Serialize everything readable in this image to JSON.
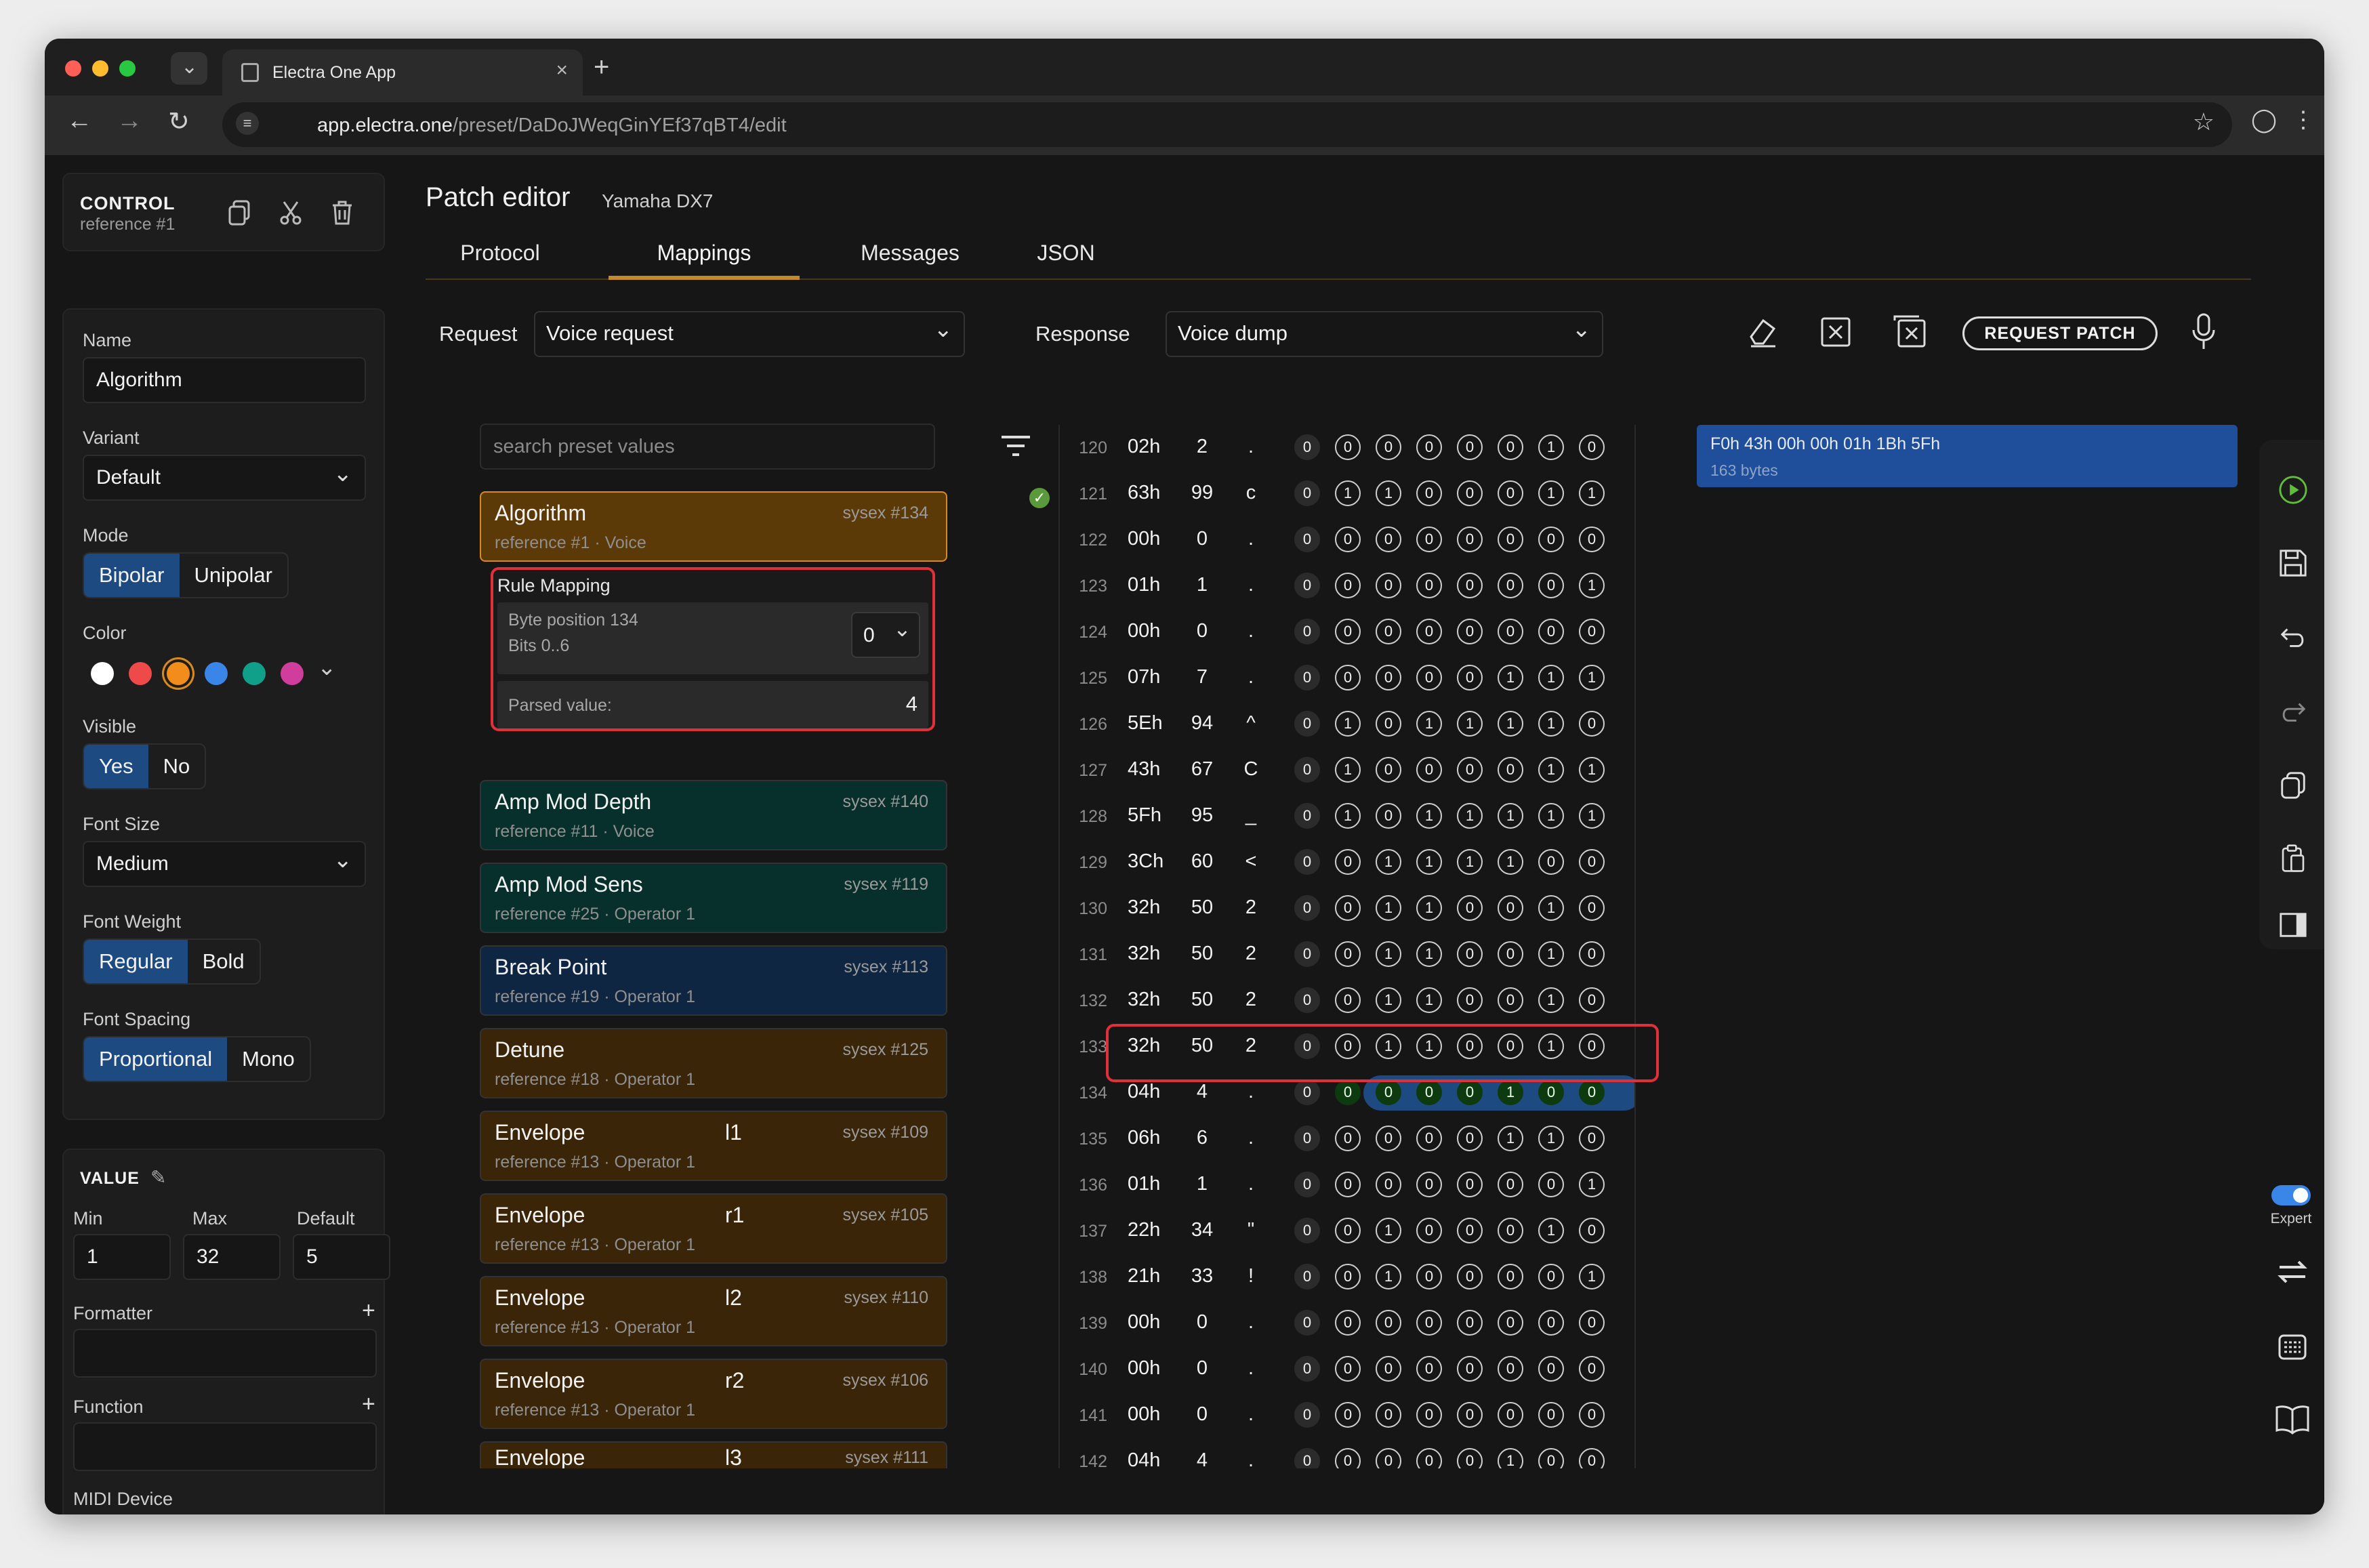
{
  "browser": {
    "tab_title": "Electra One App",
    "url_host": "app.electra.one",
    "url_path": "/preset/DaDoJWeqGinYEf37qBT4/edit"
  },
  "control": {
    "title": "CONTROL",
    "ref": "reference #1"
  },
  "props": {
    "name_label": "Name",
    "name_value": "Algorithm",
    "variant_label": "Variant",
    "variant_value": "Default",
    "mode_label": "Mode",
    "mode_options": [
      "Bipolar",
      "Unipolar"
    ],
    "color_label": "Color",
    "colors": [
      "#ffffff",
      "#ef4a4a",
      "#f28c1a",
      "#3a86e8",
      "#10a08a",
      "#d13d9c"
    ],
    "visible_label": "Visible",
    "visible_options": [
      "Yes",
      "No"
    ],
    "fontsize_label": "Font Size",
    "fontsize_value": "Medium",
    "fontweight_label": "Font Weight",
    "fontweight_options": [
      "Regular",
      "Bold"
    ],
    "fontspacing_label": "Font Spacing",
    "fontspacing_options": [
      "Proportional",
      "Mono"
    ]
  },
  "value": {
    "title": "VALUE",
    "min_label": "Min",
    "max_label": "Max",
    "default_label": "Default",
    "min": "1",
    "max": "32",
    "default": "5",
    "formatter_label": "Formatter",
    "function_label": "Function",
    "midi_label": "MIDI Device"
  },
  "editor": {
    "title": "Patch editor",
    "device": "Yamaha DX7",
    "tabs": [
      "Protocol",
      "Mappings",
      "Messages",
      "JSON"
    ],
    "request_label": "Request",
    "request_value": "Voice request",
    "response_label": "Response",
    "response_value": "Voice dump",
    "request_patch": "REQUEST PATCH",
    "search_placeholder": "search preset values"
  },
  "rule": {
    "title": "Rule Mapping",
    "byte_pos": "Byte position 134",
    "bits": "Bits 0..6",
    "select": "0",
    "parsed_label": "Parsed value:",
    "parsed_value": "4"
  },
  "mappings": [
    {
      "name": "Algorithm",
      "extra": "",
      "sysex": "sysex #134",
      "ref": "reference #1 · Voice"
    },
    {
      "name": "Amp Mod Depth",
      "extra": "",
      "sysex": "sysex #140",
      "ref": "reference #11 · Voice"
    },
    {
      "name": "Amp Mod Sens",
      "extra": "",
      "sysex": "sysex #119",
      "ref": "reference #25 · Operator 1"
    },
    {
      "name": "Break Point",
      "extra": "",
      "sysex": "sysex #113",
      "ref": "reference #19 · Operator 1"
    },
    {
      "name": "Detune",
      "extra": "",
      "sysex": "sysex #125",
      "ref": "reference #18 · Operator 1"
    },
    {
      "name": "Envelope",
      "extra": "l1",
      "sysex": "sysex #109",
      "ref": "reference #13 · Operator 1"
    },
    {
      "name": "Envelope",
      "extra": "r1",
      "sysex": "sysex #105",
      "ref": "reference #13 · Operator 1"
    },
    {
      "name": "Envelope",
      "extra": "l2",
      "sysex": "sysex #110",
      "ref": "reference #13 · Operator 1"
    },
    {
      "name": "Envelope",
      "extra": "r2",
      "sysex": "sysex #106",
      "ref": "reference #13 · Operator 1"
    },
    {
      "name": "Envelope",
      "extra": "l3",
      "sysex": "sysex #111",
      "ref": ""
    }
  ],
  "bytes": [
    {
      "i": "120",
      "hex": "02h",
      "dec": "2",
      "chr": ".",
      "bits": "00000010"
    },
    {
      "i": "121",
      "hex": "63h",
      "dec": "99",
      "chr": "c",
      "bits": "01100011"
    },
    {
      "i": "122",
      "hex": "00h",
      "dec": "0",
      "chr": ".",
      "bits": "00000000"
    },
    {
      "i": "123",
      "hex": "01h",
      "dec": "1",
      "chr": ".",
      "bits": "00000001"
    },
    {
      "i": "124",
      "hex": "00h",
      "dec": "0",
      "chr": ".",
      "bits": "00000000"
    },
    {
      "i": "125",
      "hex": "07h",
      "dec": "7",
      "chr": ".",
      "bits": "00000111"
    },
    {
      "i": "126",
      "hex": "5Eh",
      "dec": "94",
      "chr": "^",
      "bits": "01011110"
    },
    {
      "i": "127",
      "hex": "43h",
      "dec": "67",
      "chr": "C",
      "bits": "01000011"
    },
    {
      "i": "128",
      "hex": "5Fh",
      "dec": "95",
      "chr": "_",
      "bits": "01011111"
    },
    {
      "i": "129",
      "hex": "3Ch",
      "dec": "60",
      "chr": "<",
      "bits": "00111100"
    },
    {
      "i": "130",
      "hex": "32h",
      "dec": "50",
      "chr": "2",
      "bits": "00110010"
    },
    {
      "i": "131",
      "hex": "32h",
      "dec": "50",
      "chr": "2",
      "bits": "00110010"
    },
    {
      "i": "132",
      "hex": "32h",
      "dec": "50",
      "chr": "2",
      "bits": "00110010"
    },
    {
      "i": "133",
      "hex": "32h",
      "dec": "50",
      "chr": "2",
      "bits": "00110010"
    },
    {
      "i": "134",
      "hex": "04h",
      "dec": "4",
      "chr": ".",
      "bits": "00000100"
    },
    {
      "i": "135",
      "hex": "06h",
      "dec": "6",
      "chr": ".",
      "bits": "00000110"
    },
    {
      "i": "136",
      "hex": "01h",
      "dec": "1",
      "chr": ".",
      "bits": "00000001"
    },
    {
      "i": "137",
      "hex": "22h",
      "dec": "34",
      "chr": "\"",
      "bits": "00100010"
    },
    {
      "i": "138",
      "hex": "21h",
      "dec": "33",
      "chr": "!",
      "bits": "00100001"
    },
    {
      "i": "139",
      "hex": "00h",
      "dec": "0",
      "chr": ".",
      "bits": "00000000"
    },
    {
      "i": "140",
      "hex": "00h",
      "dec": "0",
      "chr": ".",
      "bits": "00000000"
    },
    {
      "i": "141",
      "hex": "00h",
      "dec": "0",
      "chr": ".",
      "bits": "00000000"
    },
    {
      "i": "142",
      "hex": "04h",
      "dec": "4",
      "chr": ".",
      "bits": "00000100"
    }
  ],
  "highlight_row": "134",
  "response_box": {
    "hex": "F0h 43h 00h 00h 01h 1Bh 5Fh",
    "size": "163 bytes"
  },
  "rail": {
    "expert_label": "Expert"
  },
  "icons": [
    "copy-icon",
    "scissors-icon",
    "trash-icon",
    "eraser-icon",
    "clear-icon",
    "clear-all-icon",
    "microphone-icon",
    "play-icon",
    "save-icon",
    "undo-icon",
    "redo-icon",
    "copy-icon",
    "paste-icon",
    "sidebar-icon",
    "swap-icon",
    "keyboard-icon",
    "book-icon"
  ]
}
